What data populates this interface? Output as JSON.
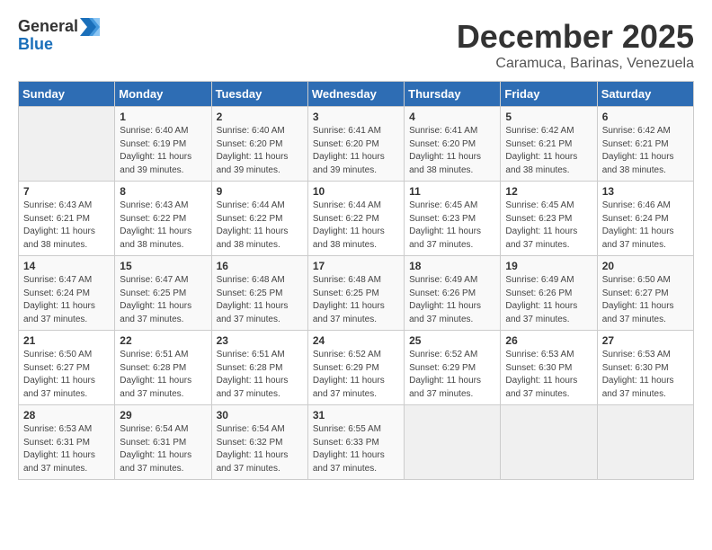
{
  "logo": {
    "general": "General",
    "blue": "Blue"
  },
  "title": {
    "month": "December 2025",
    "location": "Caramuca, Barinas, Venezuela"
  },
  "headers": [
    "Sunday",
    "Monday",
    "Tuesday",
    "Wednesday",
    "Thursday",
    "Friday",
    "Saturday"
  ],
  "weeks": [
    [
      {
        "day": "",
        "sunrise": "",
        "sunset": "",
        "daylight": ""
      },
      {
        "day": "1",
        "sunrise": "Sunrise: 6:40 AM",
        "sunset": "Sunset: 6:19 PM",
        "daylight": "Daylight: 11 hours and 39 minutes."
      },
      {
        "day": "2",
        "sunrise": "Sunrise: 6:40 AM",
        "sunset": "Sunset: 6:20 PM",
        "daylight": "Daylight: 11 hours and 39 minutes."
      },
      {
        "day": "3",
        "sunrise": "Sunrise: 6:41 AM",
        "sunset": "Sunset: 6:20 PM",
        "daylight": "Daylight: 11 hours and 39 minutes."
      },
      {
        "day": "4",
        "sunrise": "Sunrise: 6:41 AM",
        "sunset": "Sunset: 6:20 PM",
        "daylight": "Daylight: 11 hours and 38 minutes."
      },
      {
        "day": "5",
        "sunrise": "Sunrise: 6:42 AM",
        "sunset": "Sunset: 6:21 PM",
        "daylight": "Daylight: 11 hours and 38 minutes."
      },
      {
        "day": "6",
        "sunrise": "Sunrise: 6:42 AM",
        "sunset": "Sunset: 6:21 PM",
        "daylight": "Daylight: 11 hours and 38 minutes."
      }
    ],
    [
      {
        "day": "7",
        "sunrise": "Sunrise: 6:43 AM",
        "sunset": "Sunset: 6:21 PM",
        "daylight": "Daylight: 11 hours and 38 minutes."
      },
      {
        "day": "8",
        "sunrise": "Sunrise: 6:43 AM",
        "sunset": "Sunset: 6:22 PM",
        "daylight": "Daylight: 11 hours and 38 minutes."
      },
      {
        "day": "9",
        "sunrise": "Sunrise: 6:44 AM",
        "sunset": "Sunset: 6:22 PM",
        "daylight": "Daylight: 11 hours and 38 minutes."
      },
      {
        "day": "10",
        "sunrise": "Sunrise: 6:44 AM",
        "sunset": "Sunset: 6:22 PM",
        "daylight": "Daylight: 11 hours and 38 minutes."
      },
      {
        "day": "11",
        "sunrise": "Sunrise: 6:45 AM",
        "sunset": "Sunset: 6:23 PM",
        "daylight": "Daylight: 11 hours and 37 minutes."
      },
      {
        "day": "12",
        "sunrise": "Sunrise: 6:45 AM",
        "sunset": "Sunset: 6:23 PM",
        "daylight": "Daylight: 11 hours and 37 minutes."
      },
      {
        "day": "13",
        "sunrise": "Sunrise: 6:46 AM",
        "sunset": "Sunset: 6:24 PM",
        "daylight": "Daylight: 11 hours and 37 minutes."
      }
    ],
    [
      {
        "day": "14",
        "sunrise": "Sunrise: 6:47 AM",
        "sunset": "Sunset: 6:24 PM",
        "daylight": "Daylight: 11 hours and 37 minutes."
      },
      {
        "day": "15",
        "sunrise": "Sunrise: 6:47 AM",
        "sunset": "Sunset: 6:25 PM",
        "daylight": "Daylight: 11 hours and 37 minutes."
      },
      {
        "day": "16",
        "sunrise": "Sunrise: 6:48 AM",
        "sunset": "Sunset: 6:25 PM",
        "daylight": "Daylight: 11 hours and 37 minutes."
      },
      {
        "day": "17",
        "sunrise": "Sunrise: 6:48 AM",
        "sunset": "Sunset: 6:25 PM",
        "daylight": "Daylight: 11 hours and 37 minutes."
      },
      {
        "day": "18",
        "sunrise": "Sunrise: 6:49 AM",
        "sunset": "Sunset: 6:26 PM",
        "daylight": "Daylight: 11 hours and 37 minutes."
      },
      {
        "day": "19",
        "sunrise": "Sunrise: 6:49 AM",
        "sunset": "Sunset: 6:26 PM",
        "daylight": "Daylight: 11 hours and 37 minutes."
      },
      {
        "day": "20",
        "sunrise": "Sunrise: 6:50 AM",
        "sunset": "Sunset: 6:27 PM",
        "daylight": "Daylight: 11 hours and 37 minutes."
      }
    ],
    [
      {
        "day": "21",
        "sunrise": "Sunrise: 6:50 AM",
        "sunset": "Sunset: 6:27 PM",
        "daylight": "Daylight: 11 hours and 37 minutes."
      },
      {
        "day": "22",
        "sunrise": "Sunrise: 6:51 AM",
        "sunset": "Sunset: 6:28 PM",
        "daylight": "Daylight: 11 hours and 37 minutes."
      },
      {
        "day": "23",
        "sunrise": "Sunrise: 6:51 AM",
        "sunset": "Sunset: 6:28 PM",
        "daylight": "Daylight: 11 hours and 37 minutes."
      },
      {
        "day": "24",
        "sunrise": "Sunrise: 6:52 AM",
        "sunset": "Sunset: 6:29 PM",
        "daylight": "Daylight: 11 hours and 37 minutes."
      },
      {
        "day": "25",
        "sunrise": "Sunrise: 6:52 AM",
        "sunset": "Sunset: 6:29 PM",
        "daylight": "Daylight: 11 hours and 37 minutes."
      },
      {
        "day": "26",
        "sunrise": "Sunrise: 6:53 AM",
        "sunset": "Sunset: 6:30 PM",
        "daylight": "Daylight: 11 hours and 37 minutes."
      },
      {
        "day": "27",
        "sunrise": "Sunrise: 6:53 AM",
        "sunset": "Sunset: 6:30 PM",
        "daylight": "Daylight: 11 hours and 37 minutes."
      }
    ],
    [
      {
        "day": "28",
        "sunrise": "Sunrise: 6:53 AM",
        "sunset": "Sunset: 6:31 PM",
        "daylight": "Daylight: 11 hours and 37 minutes."
      },
      {
        "day": "29",
        "sunrise": "Sunrise: 6:54 AM",
        "sunset": "Sunset: 6:31 PM",
        "daylight": "Daylight: 11 hours and 37 minutes."
      },
      {
        "day": "30",
        "sunrise": "Sunrise: 6:54 AM",
        "sunset": "Sunset: 6:32 PM",
        "daylight": "Daylight: 11 hours and 37 minutes."
      },
      {
        "day": "31",
        "sunrise": "Sunrise: 6:55 AM",
        "sunset": "Sunset: 6:33 PM",
        "daylight": "Daylight: 11 hours and 37 minutes."
      },
      {
        "day": "",
        "sunrise": "",
        "sunset": "",
        "daylight": ""
      },
      {
        "day": "",
        "sunrise": "",
        "sunset": "",
        "daylight": ""
      },
      {
        "day": "",
        "sunrise": "",
        "sunset": "",
        "daylight": ""
      }
    ]
  ]
}
